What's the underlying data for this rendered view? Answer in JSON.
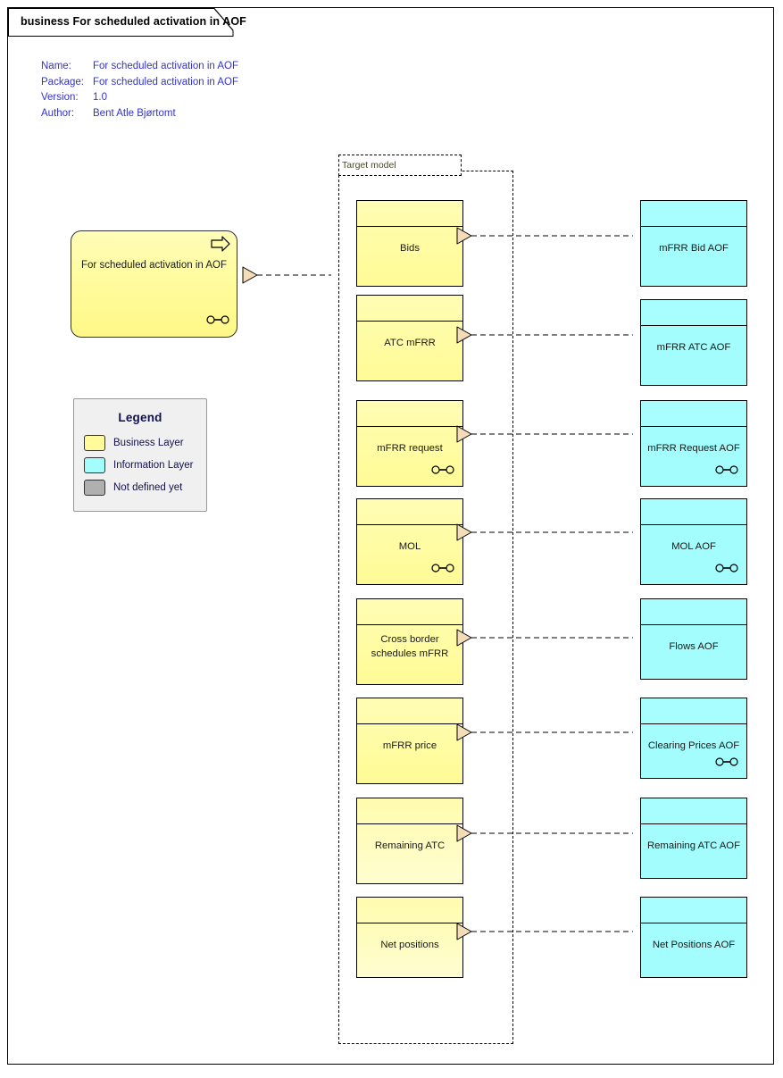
{
  "diagram": {
    "tab_title": "business For scheduled activation in AOF",
    "meta": [
      {
        "key": "Name:",
        "value": "For scheduled activation in AOF"
      },
      {
        "key": "Package:",
        "value": "For scheduled activation in AOF"
      },
      {
        "key": "Version:",
        "value": "1.0"
      },
      {
        "key": "Author:",
        "value": "Bent Atle Bjørtomt"
      }
    ]
  },
  "legend": {
    "title": "Legend",
    "items": [
      {
        "label": "Business Layer",
        "color": "#FFFB99"
      },
      {
        "label": "Information Layer",
        "color": "#A3FDFD"
      },
      {
        "label": "Not defined yet",
        "color": "#B0B0B0"
      }
    ]
  },
  "main_process": {
    "label": "For scheduled activation in AOF",
    "icon": "process-arrow-icon",
    "interface_icon": "ball-and-socket-icon"
  },
  "boundary": {
    "label": "Target model"
  },
  "business_elements": [
    {
      "name": "Bids",
      "has_interface_icon": false
    },
    {
      "name": "ATC mFRR",
      "has_interface_icon": false
    },
    {
      "name": "mFRR request",
      "has_interface_icon": true
    },
    {
      "name": "MOL",
      "has_interface_icon": true
    },
    {
      "name": "Cross border schedules mFRR",
      "has_interface_icon": false
    },
    {
      "name": "mFRR price",
      "has_interface_icon": false
    },
    {
      "name": "Remaining ATC",
      "has_interface_icon": false
    },
    {
      "name": "Net positions",
      "has_interface_icon": false
    }
  ],
  "information_elements": [
    {
      "name": "mFRR Bid AOF",
      "has_interface_icon": false
    },
    {
      "name": "mFRR ATC AOF",
      "has_interface_icon": false
    },
    {
      "name": "mFRR Request AOF",
      "has_interface_icon": true
    },
    {
      "name": "MOL AOF",
      "has_interface_icon": true
    },
    {
      "name": "Flows AOF",
      "has_interface_icon": false
    },
    {
      "name": "Clearing Prices AOF",
      "has_interface_icon": true
    },
    {
      "name": "Remaining ATC AOF",
      "has_interface_icon": false
    },
    {
      "name": "Net Positions AOF",
      "has_interface_icon": false
    }
  ],
  "colors": {
    "business_fill": "#FFFB99",
    "information_fill": "#A3FDFD",
    "not_defined_fill": "#B0B0B0",
    "arrowhead_fill": "#F5DEB3",
    "text_blue": "#3333CC",
    "legend_text": "#11114E"
  }
}
